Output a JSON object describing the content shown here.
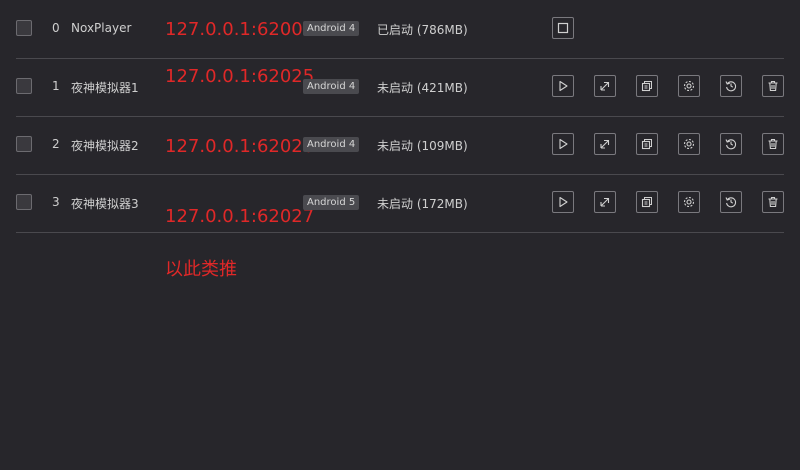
{
  "rows": [
    {
      "index": "0",
      "name": "NoxPlayer",
      "annotation": "127.0.0.1:62001",
      "android": "Android 4",
      "status": "已启动 (786MB)",
      "actions": [
        "stop-icon"
      ]
    },
    {
      "index": "1",
      "name": "夜神模拟器1",
      "annotation": "127.0.0.1:62025",
      "android": "Android 4",
      "status": "未启动 (421MB)",
      "actions": [
        "play-icon",
        "shortcut-icon",
        "copy-icon",
        "gear-icon",
        "restore-icon",
        "trash-icon"
      ]
    },
    {
      "index": "2",
      "name": "夜神模拟器2",
      "annotation": "127.0.0.1:62026",
      "android": "Android 4",
      "status": "未启动 (109MB)",
      "actions": [
        "play-icon",
        "shortcut-icon",
        "copy-icon",
        "gear-icon",
        "restore-icon",
        "trash-icon"
      ]
    },
    {
      "index": "3",
      "name": "夜神模拟器3",
      "annotation": "127.0.0.1:62027",
      "android": "Android 5",
      "status": "未启动 (172MB)",
      "actions": [
        "play-icon",
        "shortcut-icon",
        "copy-icon",
        "gear-icon",
        "restore-icon",
        "trash-icon"
      ]
    }
  ],
  "footer_note": "以此类推",
  "colors": {
    "background": "#27262b",
    "annotation_red": "#e02828",
    "divider": "#4a494e",
    "badge_bg": "#4a4a4f"
  }
}
